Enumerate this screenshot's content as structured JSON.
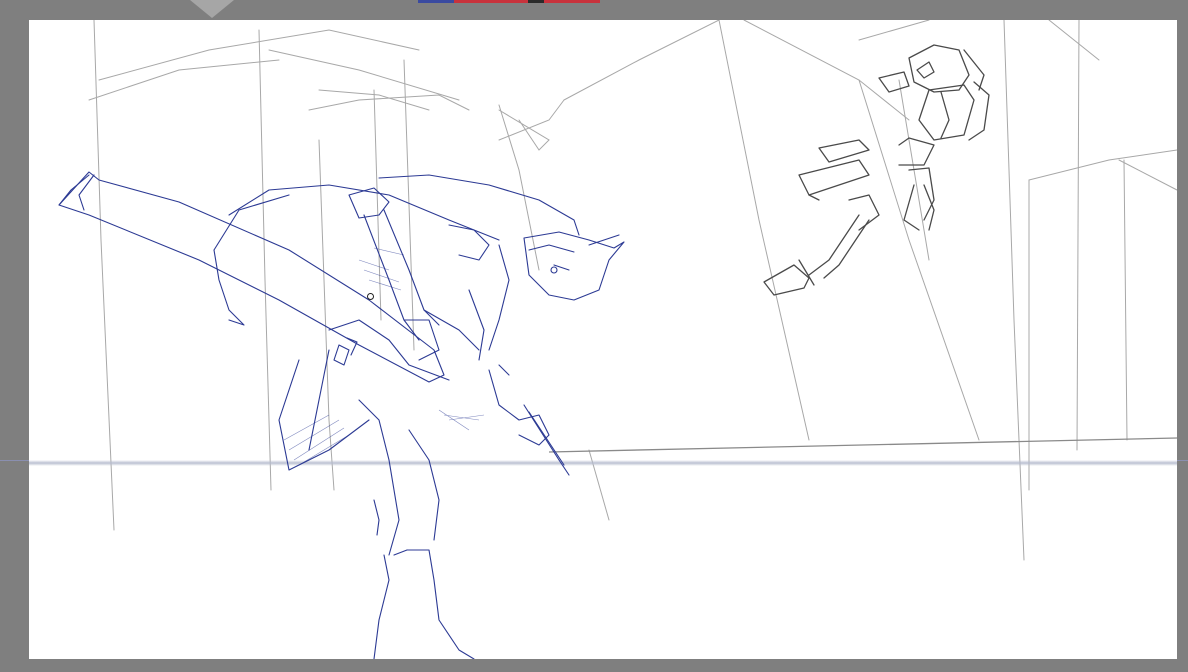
{
  "app": {
    "workspace_background": "#7f7f7f",
    "canvas_background": "#ffffff"
  },
  "color_strip": {
    "swatches": [
      "#3a4aa0",
      "#c8323c",
      "#c8323c",
      "#2a2a2a",
      "#c8323c"
    ]
  },
  "canvas": {
    "layer_colors": {
      "sketch_blue": "#2c3a94",
      "sketch_gray": "#4a4a4a",
      "background_lines": "#9a9a9a"
    },
    "cursor_icon": "brush-cursor-icon"
  }
}
